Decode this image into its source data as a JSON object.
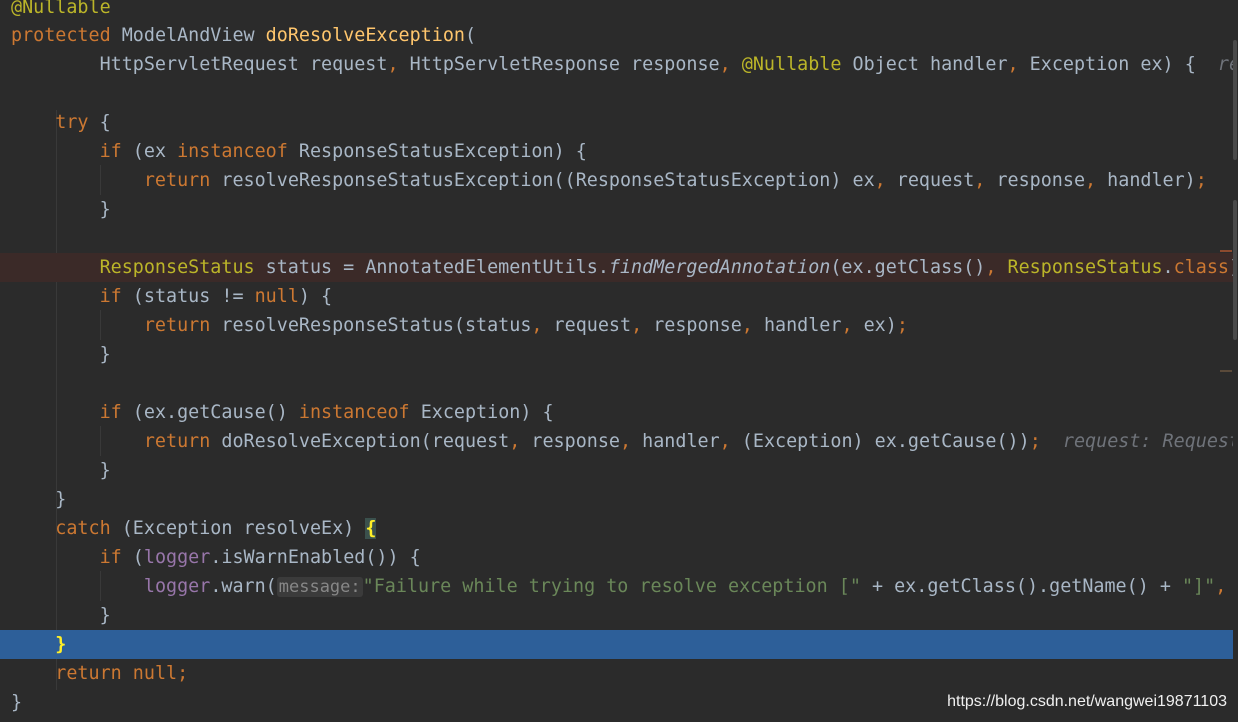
{
  "code": {
    "line1_ann": "@Nullable",
    "l2_protected": "protected",
    "l2_type": " ModelAndView ",
    "l2_fn": "doResolveException",
    "l2_paren": "(",
    "l3_a": "        HttpServletRequest request",
    "l3_comma1": ",",
    "l3_b": " HttpServletResponse response",
    "l3_comma2": ",",
    "l3_ann": " @Nullable",
    "l3_c": " Object handler",
    "l3_comma3": ",",
    "l3_d": " Exception ex) {  ",
    "l3_hint": "re",
    "l5_try": "    try",
    "l5_rest": " {",
    "l6_if": "        if",
    "l6_a": " (ex ",
    "l6_instanceof": "instanceof",
    "l6_b": " ResponseStatusException) {",
    "l7_return": "            return",
    "l7_a": " resolveResponseStatusException((ResponseStatusException) ex",
    "l7_c1": ",",
    "l7_b": " request",
    "l7_c2": ",",
    "l7_c": " response",
    "l7_c3": ",",
    "l7_d": " handler)",
    "l7_semi": ";",
    "l8": "        }",
    "l10_type": "        ResponseStatus",
    "l10_a": " status = AnnotatedElementUtils.",
    "l10_fn": "findMergedAnnotation",
    "l10_b": "(ex.getClass()",
    "l10_comma": ",",
    "l10_type2": " ResponseStatus",
    "l10_dot": ".",
    "l10_class": "class",
    "l10_end": ")",
    "l11_if": "        if",
    "l11_a": " (status != ",
    "l11_null": "null",
    "l11_b": ") {",
    "l12_return": "            return",
    "l12_a": " resolveResponseStatus(status",
    "l12_c1": ",",
    "l12_b": " request",
    "l12_c2": ",",
    "l12_c": " response",
    "l12_c3": ",",
    "l12_d": " handler",
    "l12_c4": ",",
    "l12_e": " ex)",
    "l12_semi": ";",
    "l13": "        }",
    "l15_if": "        if",
    "l15_a": " (ex.getCause() ",
    "l15_instanceof": "instanceof",
    "l15_b": " Exception) {",
    "l16_return": "            return",
    "l16_a": " doResolveException(request",
    "l16_c1": ",",
    "l16_b": " response",
    "l16_c2": ",",
    "l16_c": " handler",
    "l16_c3": ",",
    "l16_d": " (Exception) ex.getCause())",
    "l16_semi": ";",
    "l16_hint": "  request: Request",
    "l17": "        }",
    "l18": "    }",
    "l19_catch": "    catch",
    "l19_a": " (Exception resolveEx) ",
    "l19_brace": "{",
    "l20_if": "        if",
    "l20_a": " (",
    "l20_logger": "logger",
    "l20_b": ".isWarnEnabled()) {",
    "l21_indent": "            ",
    "l21_logger": "logger",
    "l21_a": ".warn(",
    "l21_hint": "message:",
    "l21_str": "\"Failure while trying to resolve exception [\"",
    "l21_b": " + ex.getClass().getName() + ",
    "l21_str2": "\"]\"",
    "l21_comma": ",",
    "l22": "        }",
    "l23_indent": "    ",
    "l23_brace": "}",
    "l24_return": "    return",
    "l24_null": " null",
    "l24_semi": ";",
    "l25": "}"
  },
  "watermark": "https://blog.csdn.net/wangwei19871103",
  "colors": {
    "background": "#2b2b2b",
    "keyword": "#cc7832",
    "annotation": "#bbb529",
    "method": "#ffc66d",
    "string": "#6a8759",
    "field": "#9876aa",
    "text": "#a9b7c6",
    "selection": "#2d5f99"
  }
}
